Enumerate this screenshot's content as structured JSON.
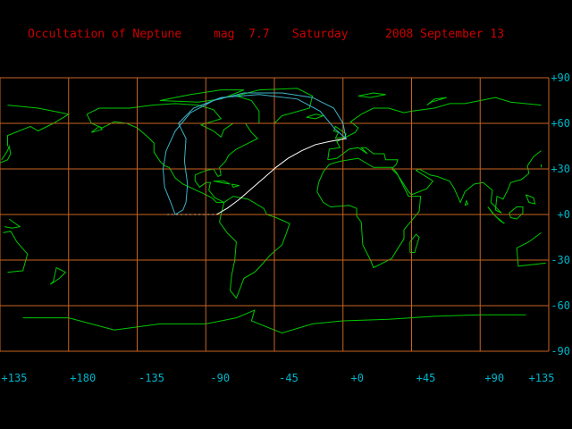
{
  "title": {
    "event": "Occultation of Neptune",
    "magnitude": "mag  7.7",
    "weekday": "Saturday",
    "date": "2008 September 13"
  },
  "colors": {
    "background": "#000000",
    "title_text": "#cc0000",
    "axis_labels": "#00b4c8",
    "grid": "#c86420",
    "coastline": "#00c800",
    "visibility_curve": "#3cb4c8",
    "track": "#ffffff"
  },
  "map": {
    "projection": "equirectangular",
    "latitude_labels": [
      "+90",
      "+60",
      "+30",
      "+0",
      "-30",
      "-60",
      "-90"
    ],
    "longitude_labels": [
      "+135",
      "+180",
      "-135",
      "-90",
      "-45",
      "+0",
      "+45",
      "+90",
      "+135"
    ],
    "occultation_track": [
      [
        -83,
        0
      ],
      [
        -76,
        4
      ],
      [
        -68,
        10
      ],
      [
        -60,
        17
      ],
      [
        -52,
        24
      ],
      [
        -44,
        31
      ],
      [
        -36,
        37
      ],
      [
        -27,
        42
      ],
      [
        -18,
        46
      ],
      [
        -9,
        48
      ],
      [
        2,
        50
      ]
    ],
    "track_dotted_segment": [
      [
        -115,
        0
      ],
      [
        -106,
        0
      ],
      [
        -98,
        0
      ],
      [
        -90,
        0
      ],
      [
        -83,
        0
      ]
    ],
    "visibility_outline": [
      [
        -110,
        0
      ],
      [
        -113,
        8
      ],
      [
        -117,
        18
      ],
      [
        -118,
        30
      ],
      [
        -116,
        42
      ],
      [
        -110,
        55
      ],
      [
        -100,
        67
      ],
      [
        -85,
        75
      ],
      [
        -65,
        80
      ],
      [
        -40,
        80
      ],
      [
        -20,
        77
      ],
      [
        -6,
        70
      ],
      [
        0,
        60
      ],
      [
        2,
        50
      ],
      [
        -5,
        56
      ],
      [
        -15,
        68
      ],
      [
        -30,
        76
      ],
      [
        -55,
        79
      ],
      [
        -80,
        77
      ],
      [
        -98,
        70
      ],
      [
        -108,
        60
      ],
      [
        -103,
        50
      ],
      [
        -104,
        35
      ],
      [
        -102,
        20
      ],
      [
        -103,
        8
      ],
      [
        -105,
        3
      ],
      [
        -110,
        0
      ]
    ]
  }
}
